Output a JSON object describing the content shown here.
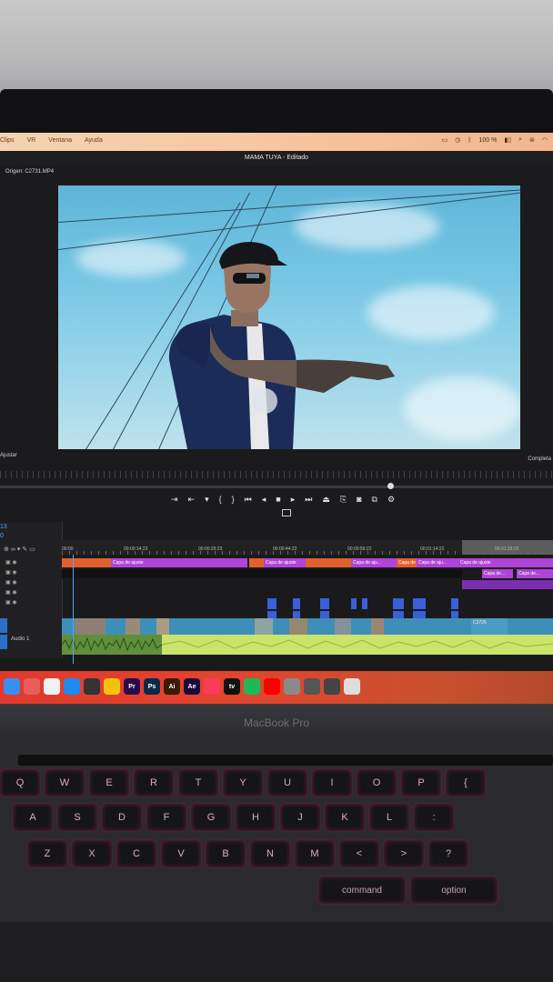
{
  "mac_menubar": {
    "items": [
      "Clips",
      "VR",
      "Ventana",
      "Ayuda"
    ],
    "status_right": [
      "100 %"
    ]
  },
  "window": {
    "title": "MAMA TUYA - Editado"
  },
  "source_monitor": {
    "origin_label": "Origen: C2731.MP4",
    "fit_label": "Ajustar",
    "quality_label": "Completa"
  },
  "transport": {
    "controls": [
      "mark-in-icon",
      "mark-out-icon",
      "marker-icon",
      "go-to-in-icon",
      "step-back-icon",
      "play-icon",
      "step-forward-icon",
      "go-to-out-icon",
      "lift-icon",
      "extract-icon",
      "export-frame-icon",
      "insert-icon",
      "overwrite-icon",
      "camera-icon"
    ]
  },
  "timeline": {
    "sequence_label": "13",
    "timecode": "0",
    "ruler_ticks": [
      "00:00",
      "00:00:14:23",
      "00:00:29:23",
      "00:00:44:22",
      "00:00:59:22",
      "00:01:14:22",
      "00:01:29:22"
    ],
    "adjustment_clips": [
      "Capa de ajuste",
      "Capa de ajuste",
      "Capa de aju...",
      "Capa de aju...",
      "Capa de aju...",
      "Capa de ajuste"
    ],
    "adjustment_clips_v2": [
      "Capa de...",
      "Capa de..."
    ],
    "audio_track_label": "Audio 1",
    "video_clip_label": "C2726"
  },
  "dock": {
    "apps": [
      {
        "name": "finder-icon",
        "label": "",
        "color": "#3a8ef0"
      },
      {
        "name": "launchpad-icon",
        "label": "",
        "color": "#e85c5c"
      },
      {
        "name": "calendar-icon",
        "label": "",
        "color": "#f1f1f1"
      },
      {
        "name": "safari-icon",
        "label": "",
        "color": "#1d8bf0"
      },
      {
        "name": "davinci-icon",
        "label": "",
        "color": "#333"
      },
      {
        "name": "chrome-icon",
        "label": "",
        "color": "#f4c20d"
      },
      {
        "name": "premiere-icon",
        "label": "Pr",
        "color": "#2a0a4a"
      },
      {
        "name": "photoshop-icon",
        "label": "Ps",
        "color": "#0b2a4a"
      },
      {
        "name": "illustrator-icon",
        "label": "Ai",
        "color": "#3a1a00"
      },
      {
        "name": "after-effects-icon",
        "label": "Ae",
        "color": "#1a0a3a"
      },
      {
        "name": "music-icon",
        "label": "",
        "color": "#fa3b5a"
      },
      {
        "name": "apple-tv-icon",
        "label": "tv",
        "color": "#111"
      },
      {
        "name": "spotify-icon",
        "label": "",
        "color": "#1db954"
      },
      {
        "name": "youtube-icon",
        "label": "",
        "color": "#ff0000"
      },
      {
        "name": "settings-icon",
        "label": "",
        "color": "#8a8a8a"
      },
      {
        "name": "preview-icon",
        "label": "",
        "color": "#555"
      },
      {
        "name": "screenshot-icon",
        "label": "",
        "color": "#444"
      },
      {
        "name": "trash-icon",
        "label": "",
        "color": "#ddd"
      }
    ]
  },
  "laptop": {
    "brand": "MacBook Pro",
    "keyboard_rows": [
      [
        "Q",
        "W",
        "E",
        "R",
        "T",
        "Y",
        "U",
        "I",
        "O",
        "P",
        "{"
      ],
      [
        "A",
        "S",
        "D",
        "F",
        "G",
        "H",
        "J",
        "K",
        "L",
        ":"
      ],
      [
        "Z",
        "X",
        "C",
        "V",
        "B",
        "N",
        "M",
        "<",
        ">",
        "?"
      ],
      [
        "command",
        "option"
      ]
    ]
  }
}
